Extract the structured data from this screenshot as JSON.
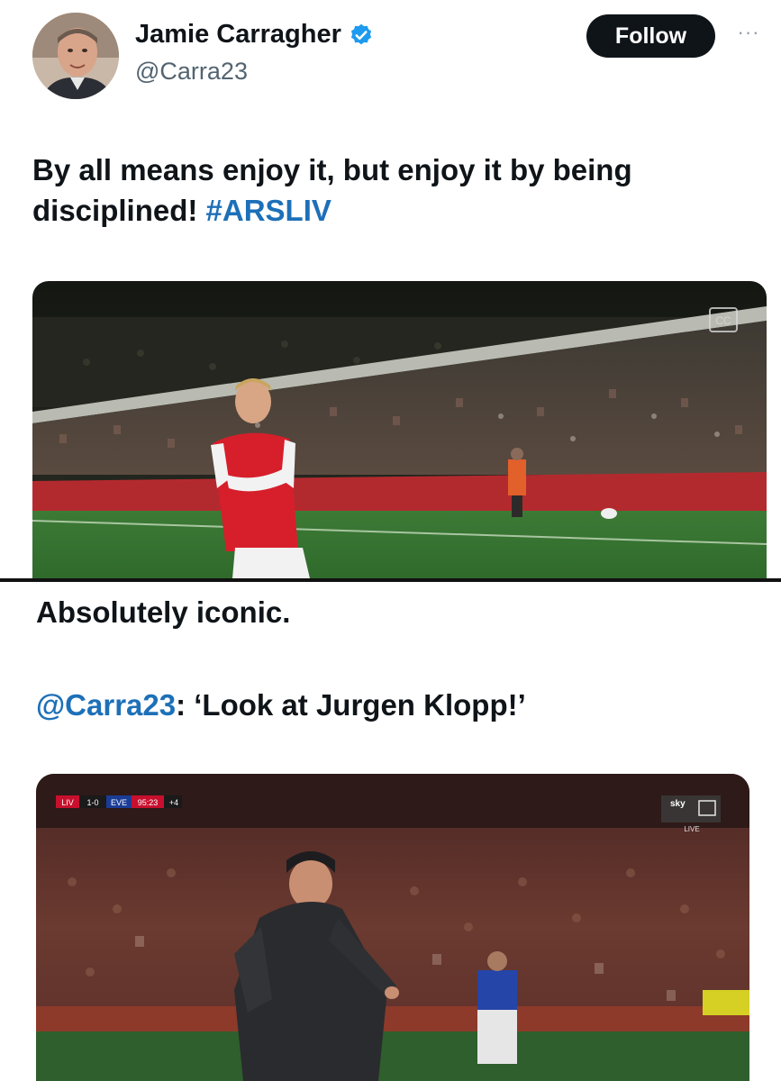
{
  "tweet": {
    "author_name": "Jamie Carragher",
    "handle": "@Carra23",
    "follow_label": "Follow",
    "more_label": "···",
    "text": "By all means enjoy it, but enjoy it by being disciplined!",
    "hashtag": "#ARSLIV",
    "media_badge": "CC"
  },
  "post": {
    "caption": "Absolutely iconic.",
    "mention": "@Carra23",
    "quote": ": ‘Look at Jurgen Klopp!’",
    "scorebug": {
      "home": "LIV",
      "score": "1-0",
      "away": "EVE",
      "clock": "95:23",
      "added": "+4"
    },
    "broadcaster": "sky",
    "broadcaster_sub": "LIVE"
  },
  "colors": {
    "accent": "#1d70b8",
    "follow_bg": "#0f1419",
    "verified": "#1d9bf0",
    "arsenal_red": "#d61f2b",
    "pitch": "#3f7d3a"
  }
}
